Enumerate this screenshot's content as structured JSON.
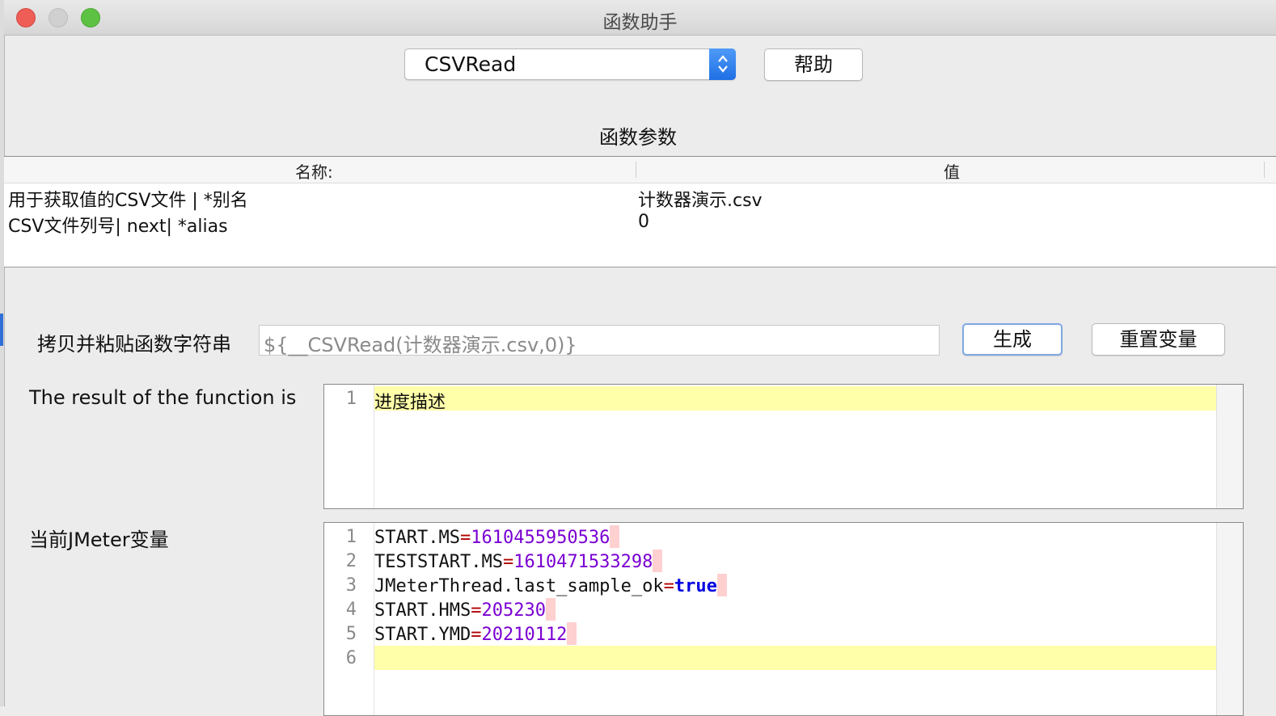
{
  "window": {
    "title": "函数助手"
  },
  "function_selector": {
    "selected": "CSVRead"
  },
  "help_button": {
    "label": "帮助"
  },
  "params_section": {
    "title": "函数参数",
    "columns": [
      "名称:",
      "值"
    ],
    "rows": [
      {
        "name": "用于获取值的CSV文件 | *别名",
        "value": "计数器演示.csv"
      },
      {
        "name": "CSV文件列号| next| *alias",
        "value": "0"
      }
    ]
  },
  "function_string": {
    "label": "拷贝并粘贴函数字符串",
    "value": "${__CSVRead(计数器演示.csv,0)}",
    "generate_label": "生成",
    "reset_label": "重置变量"
  },
  "result": {
    "label": "The result of the function is",
    "lines": [
      {
        "num": "1",
        "text": "进度描述"
      }
    ]
  },
  "variables": {
    "label": "当前JMeter变量",
    "lines": [
      {
        "num": "1",
        "key": "START.MS",
        "eq": "=",
        "val": "1610455950536"
      },
      {
        "num": "2",
        "key": "TESTSTART.MS",
        "eq": "=",
        "val": "1610471533298"
      },
      {
        "num": "3",
        "key": "JMeterThread.last_sample_ok",
        "eq": "=",
        "val": "true"
      },
      {
        "num": "4",
        "key": "START.HMS",
        "eq": "=",
        "val": "205230"
      },
      {
        "num": "5",
        "key": "START.YMD",
        "eq": "=",
        "val": "20210112"
      },
      {
        "num": "6",
        "key": "",
        "eq": "",
        "val": ""
      }
    ]
  },
  "colors": {
    "current_line": "#ffffaa",
    "number": "#7a00d2",
    "boolean": "#0000e0",
    "operator": "#b10000",
    "accent": "#1f6fe5"
  }
}
